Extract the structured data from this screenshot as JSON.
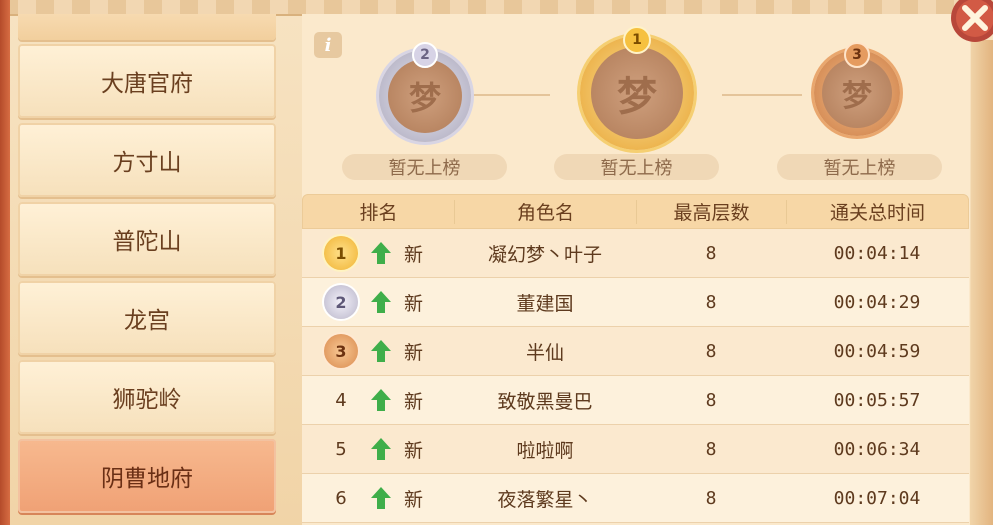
{
  "sidebar": {
    "items": [
      {
        "label": "大唐官府",
        "active": false
      },
      {
        "label": "方寸山",
        "active": false
      },
      {
        "label": "普陀山",
        "active": false
      },
      {
        "label": "龙宫",
        "active": false
      },
      {
        "label": "狮驼岭",
        "active": false
      },
      {
        "label": "阴曹地府",
        "active": true
      }
    ]
  },
  "info_icon": "i",
  "podium": [
    {
      "rank": "2",
      "label": "暂无上榜"
    },
    {
      "rank": "1",
      "label": "暂无上榜"
    },
    {
      "rank": "3",
      "label": "暂无上榜"
    }
  ],
  "medal_glyph": "梦",
  "table": {
    "headers": [
      "排名",
      "角色名",
      "最高层数",
      "通关总时间"
    ],
    "rows": [
      {
        "rank": "1",
        "trend": "新",
        "name": "凝幻梦丶叶子",
        "floor": "8",
        "time": "00:04:14"
      },
      {
        "rank": "2",
        "trend": "新",
        "name": "董建国",
        "floor": "8",
        "time": "00:04:29"
      },
      {
        "rank": "3",
        "trend": "新",
        "name": "半仙",
        "floor": "8",
        "time": "00:04:59"
      },
      {
        "rank": "4",
        "trend": "新",
        "name": "致敬黑曼巴",
        "floor": "8",
        "time": "00:05:57"
      },
      {
        "rank": "5",
        "trend": "新",
        "name": "啦啦啊",
        "floor": "8",
        "time": "00:06:34"
      },
      {
        "rank": "6",
        "trend": "新",
        "name": "夜落繁星丶",
        "floor": "8",
        "time": "00:07:04"
      }
    ]
  },
  "colors": {
    "gold": "#f4b73a",
    "silver": "#b9b5c9",
    "bronze": "#d98a4e",
    "up_arrow": "#3fae4a",
    "active_tab": "#f0a175"
  }
}
